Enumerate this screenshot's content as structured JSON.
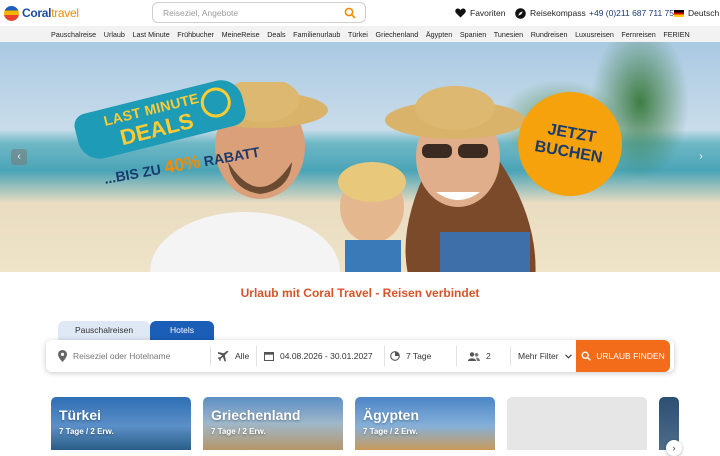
{
  "header": {
    "logo_brand": "Coral",
    "logo_suffix": "travel",
    "search_placeholder": "Reiseziel, Angebote",
    "favorites_label": "Favoriten",
    "compass_label": "Reisekompass",
    "phone": "+49 (0)211 687 711 75",
    "language": "Deutsch"
  },
  "nav": [
    "Pauschalreise",
    "Urlaub",
    "Last Minute",
    "Frühbucher",
    "MeineReise",
    "Deals",
    "Familienurlaub",
    "Türkei",
    "Griechenland",
    "Ägypten",
    "Spanien",
    "Tunesien",
    "Rundreisen",
    "Luxusreisen",
    "Fernreisen",
    "FERIEN"
  ],
  "hero": {
    "badge_line1": "LAST MINUTE",
    "badge_line2": "DEALS",
    "rabatt_prefix": "...BIS ZU ",
    "rabatt_value": "40%",
    "rabatt_suffix": " RABATT",
    "cta": "JETZT BUCHEN",
    "slide_count": 10,
    "active_slide": 1
  },
  "tagline": "Urlaub mit Coral Travel - Reisen verbindet",
  "tabs": {
    "pauschal": "Pauschalreisen",
    "hotels": "Hotels",
    "active": "Hotels"
  },
  "searchbar": {
    "destination_placeholder": "Reiseziel oder Hotelname",
    "transport": "Alle",
    "dates": "04.08.2026 - 30.01.2027",
    "duration": "7 Tage",
    "persons": "2",
    "filter": "Mehr Filter",
    "button": "URLAUB FINDEN"
  },
  "cards": [
    {
      "title": "Türkei",
      "sub": "7 Tage / 2 Erw."
    },
    {
      "title": "Griechenland",
      "sub": "7 Tage / 2 Erw."
    },
    {
      "title": "Ägypten",
      "sub": "7 Tage / 2 Erw."
    }
  ],
  "colors": {
    "brand_blue": "#1a5eb8",
    "accent_orange": "#f26c1a",
    "tagline": "#d8542a"
  }
}
